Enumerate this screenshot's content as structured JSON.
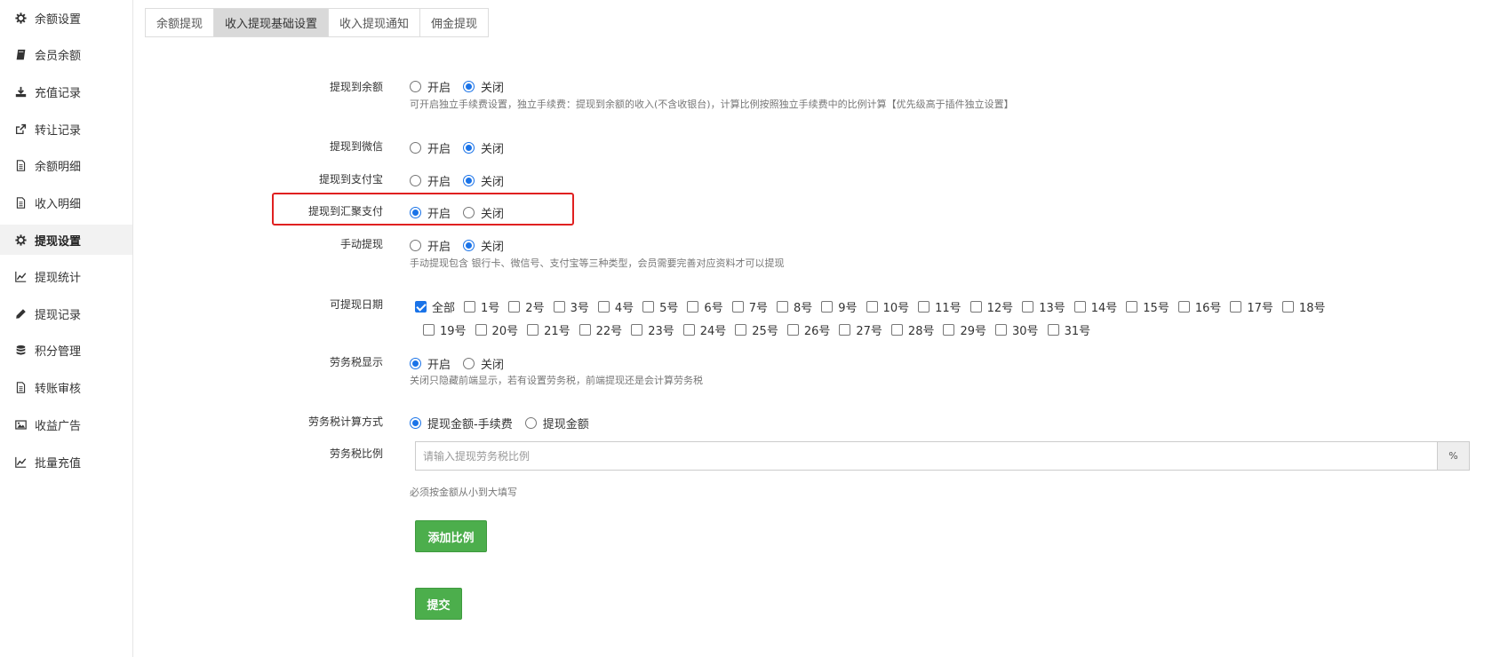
{
  "sidebar": {
    "items": [
      {
        "label": "余额设置",
        "icon": "gear-icon"
      },
      {
        "label": "会员余额",
        "icon": "book-icon"
      },
      {
        "label": "充值记录",
        "icon": "download-icon"
      },
      {
        "label": "转让记录",
        "icon": "external-link-icon"
      },
      {
        "label": "余额明细",
        "icon": "file-icon"
      },
      {
        "label": "收入明细",
        "icon": "file-icon"
      },
      {
        "label": "提现设置",
        "icon": "gear-icon",
        "active": true
      },
      {
        "label": "提现统计",
        "icon": "line-chart-icon"
      },
      {
        "label": "提现记录",
        "icon": "pencil-icon"
      },
      {
        "label": "积分管理",
        "icon": "database-icon"
      },
      {
        "label": "转账审核",
        "icon": "file-icon"
      },
      {
        "label": "收益广告",
        "icon": "image-icon"
      },
      {
        "label": "批量充值",
        "icon": "line-chart-icon"
      }
    ]
  },
  "tabs": [
    {
      "label": "余额提现",
      "active": false
    },
    {
      "label": "收入提现基础设置",
      "active": true
    },
    {
      "label": "收入提现通知",
      "active": false
    },
    {
      "label": "佣金提现",
      "active": false
    }
  ],
  "form": {
    "to_balance": {
      "label": "提现到余额",
      "on": "开启",
      "off": "关闭",
      "value": "off",
      "help": "可开启独立手续费设置，独立手续费：提现到余额的收入(不含收银台)，计算比例按照独立手续费中的比例计算【优先级高于插件独立设置】"
    },
    "to_wechat": {
      "label": "提现到微信",
      "on": "开启",
      "off": "关闭",
      "value": "off"
    },
    "to_alipay": {
      "label": "提现到支付宝",
      "on": "开启",
      "off": "关闭",
      "value": "off"
    },
    "to_huiju": {
      "label": "提现到汇聚支付",
      "on": "开启",
      "off": "关闭",
      "value": "on"
    },
    "manual": {
      "label": "手动提现",
      "on": "开启",
      "off": "关闭",
      "value": "off",
      "help": "手动提现包含 银行卡、微信号、支付宝等三种类型，会员需要完善对应资料才可以提现"
    },
    "dates": {
      "label": "可提现日期",
      "all_label": "全部",
      "all_checked": true,
      "days_line1": [
        "1号",
        "2号",
        "3号",
        "4号",
        "5号",
        "6号",
        "7号",
        "8号",
        "9号",
        "10号",
        "11号",
        "12号",
        "13号",
        "14号",
        "15号",
        "16号",
        "17号",
        "18号"
      ],
      "days_line2": [
        "19号",
        "20号",
        "21号",
        "22号",
        "23号",
        "24号",
        "25号",
        "26号",
        "27号",
        "28号",
        "29号",
        "30号",
        "31号"
      ]
    },
    "tax_display": {
      "label": "劳务税显示",
      "on": "开启",
      "off": "关闭",
      "value": "on",
      "help": "关闭只隐藏前端显示，若有设置劳务税，前端提现还是会计算劳务税"
    },
    "tax_method": {
      "label": "劳务税计算方式",
      "opt1": "提现金额-手续费",
      "opt2": "提现金额",
      "value": "opt1"
    },
    "tax_ratio": {
      "label": "劳务税比例",
      "placeholder": "请输入提现劳务税比例",
      "value": "",
      "addon": "%",
      "help": "必须按金额从小到大填写"
    },
    "add_button": "添加比例",
    "submit_button": "提交"
  },
  "colors": {
    "accent": "#1a73e8",
    "button_green": "#4cae4c",
    "highlight": "#e02020"
  }
}
